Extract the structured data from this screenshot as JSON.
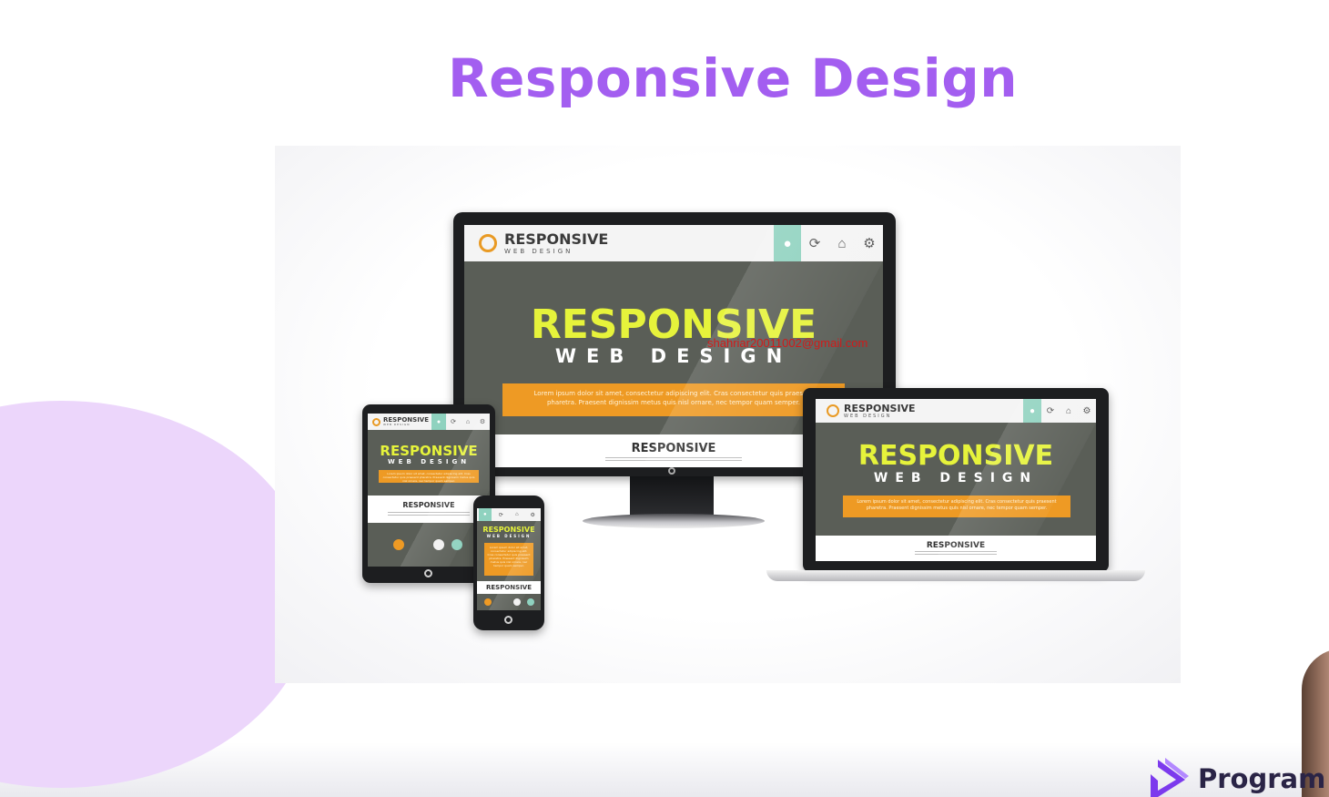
{
  "slide": {
    "title": "Responsive Design",
    "watermark": "shahriar20011002@gmail.com",
    "brand_name": "Program"
  },
  "illustration": {
    "logo_title": "RESPONSIVE",
    "logo_subtitle": "WEB DESIGN",
    "hero_title": "RESPONSIVE",
    "hero_subtitle": "WEB DESIGN",
    "body_text": "Lorem ipsum dolor sit amet, consectetur adipiscing elit. Cras consectetur quis praesent pharetra. Praesent dignissim metus quis nisl ornare, nec tempor quam semper.",
    "band_title": "RESPONSIVE",
    "header_icons": [
      "user-icon",
      "refresh-icon",
      "home-icon",
      "gear-icon"
    ]
  },
  "colors": {
    "title_purple": "#a35ef0",
    "hero_yellow": "#e6f33b",
    "orange": "#ee9a24",
    "teal": "#8fd2bf",
    "screen_gray": "#5a5e57",
    "circle_lilac": "#ecd6fb"
  }
}
